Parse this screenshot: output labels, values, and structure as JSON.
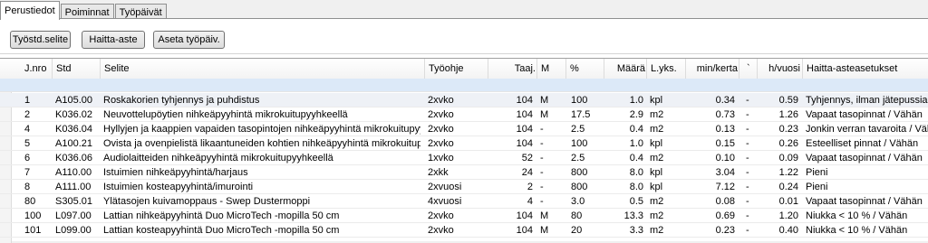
{
  "tabs": [
    "Perustiedot",
    "Poiminnat",
    "Työpäivät"
  ],
  "buttons": {
    "tyostd": "Työstd.selite",
    "haitta": "Haitta-aste",
    "aseta": "Aseta työpäiv."
  },
  "columns": [
    "J.nro",
    "Std",
    "Selite",
    "Työohje",
    "Taaj.",
    "M",
    "%",
    "Määrä",
    "L.yks.",
    "min/kerta",
    "`",
    "h/vuosi",
    "Haitta-asteasetukset"
  ],
  "rows": [
    {
      "jnro": "1",
      "std": "A105.00",
      "selite": "Roskakorien tyhjennys ja puhdistus",
      "tyoohje": "2xvko",
      "taaj": "104",
      "m": "M",
      "pct": "100",
      "maara": "1.0",
      "lyks": "kpl",
      "min": "0.34",
      "tick": "-",
      "hv": "0.59",
      "haitta": "Tyhjennys, ilman jätepussia"
    },
    {
      "jnro": "2",
      "std": "K036.02",
      "selite": "Neuvottelupöytien nihkeäpyyhintä mikrokuitupyyhkeellä",
      "tyoohje": "2xvko",
      "taaj": "104",
      "m": "M",
      "pct": "17.5",
      "maara": "2.9",
      "lyks": "m2",
      "min": "0.73",
      "tick": "-",
      "hv": "1.26",
      "haitta": "Vapaat tasopinnat / Vähän"
    },
    {
      "jnro": "4",
      "std": "K036.04",
      "selite": "Hyllyjen ja kaappien vapaiden tasopintojen nihkeäpyyhintä mikrokuitupyyhke...",
      "tyoohje": "2xvko",
      "taaj": "104",
      "m": "-",
      "pct": "2.5",
      "maara": "0.4",
      "lyks": "m2",
      "min": "0.13",
      "tick": "-",
      "hv": "0.23",
      "haitta": "Jonkin verran tavaroita / Vähän"
    },
    {
      "jnro": "5",
      "std": "A100.21",
      "selite": "Ovista ja ovenpielistä likaantuneiden kohtien nihkeäpyyhintä mikrokuitupyyhk...",
      "tyoohje": "2xvko",
      "taaj": "104",
      "m": "-",
      "pct": "100",
      "maara": "1.0",
      "lyks": "kpl",
      "min": "0.15",
      "tick": "-",
      "hv": "0.26",
      "haitta": "Esteelliset pinnat / Vähän"
    },
    {
      "jnro": "6",
      "std": "K036.06",
      "selite": "Audiolaitteiden nihkeäpyyhintä mikrokuitupyyhkeellä",
      "tyoohje": "1xvko",
      "taaj": "52",
      "m": "-",
      "pct": "2.5",
      "maara": "0.4",
      "lyks": "m2",
      "min": "0.10",
      "tick": "-",
      "hv": "0.09",
      "haitta": "Vapaat tasopinnat / Vähän"
    },
    {
      "jnro": "7",
      "std": "A110.00",
      "selite": "Istuimien nihkeäpyyhintä/harjaus",
      "tyoohje": "2xkk",
      "taaj": "24",
      "m": "-",
      "pct": "800",
      "maara": "8.0",
      "lyks": "kpl",
      "min": "3.04",
      "tick": "-",
      "hv": "1.22",
      "haitta": "Pieni"
    },
    {
      "jnro": "8",
      "std": "A111.00",
      "selite": "Istuimien kosteapyyhintä/imurointi",
      "tyoohje": "2xvuosi",
      "taaj": "2",
      "m": "-",
      "pct": "800",
      "maara": "8.0",
      "lyks": "kpl",
      "min": "7.12",
      "tick": "-",
      "hv": "0.24",
      "haitta": "Pieni"
    },
    {
      "jnro": "80",
      "std": "S305.01",
      "selite": "Ylätasojen kuivamoppaus - Swep Dustermoppi",
      "tyoohje": "4xvuosi",
      "taaj": "4",
      "m": "-",
      "pct": "3.0",
      "maara": "0.5",
      "lyks": "m2",
      "min": "0.08",
      "tick": "-",
      "hv": "0.01",
      "haitta": "Vapaat tasopinnat / Vähän"
    },
    {
      "jnro": "100",
      "std": "L097.00",
      "selite": "Lattian nihkeäpyyhintä Duo MicroTech -mopilla 50 cm",
      "tyoohje": "2xvko",
      "taaj": "104",
      "m": "M",
      "pct": "80",
      "maara": "13.3",
      "lyks": "m2",
      "min": "0.69",
      "tick": "-",
      "hv": "1.20",
      "haitta": "Niukka < 10 % / Vähän"
    },
    {
      "jnro": "101",
      "std": "L099.00",
      "selite": "Lattian kosteapyyhintä Duo MicroTech -mopilla 50 cm",
      "tyoohje": "2xvko",
      "taaj": "104",
      "m": "M",
      "pct": "20",
      "maara": "3.3",
      "lyks": "m2",
      "min": "0.23",
      "tick": "-",
      "hv": "0.40",
      "haitta": "Niukka < 10 % / Vähän"
    }
  ]
}
